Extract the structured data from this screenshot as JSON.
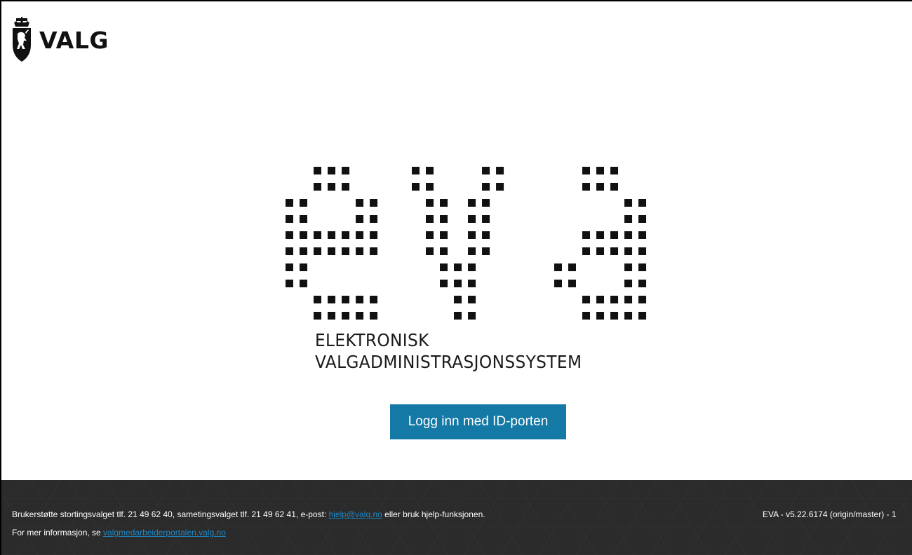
{
  "header": {
    "brand_text": "VALG",
    "emblem_icon": "norwegian-coat-of-arms-icon"
  },
  "hero": {
    "logo_text": "eva",
    "logo_icon": "eva-dot-matrix-logo",
    "subtitle_line1": "ELEKTRONISK",
    "subtitle_line2": "VALGADMINISTRASJONSSYSTEM"
  },
  "login": {
    "button_label": "Logg inn med ID-porten"
  },
  "footer": {
    "support_prefix": "Brukerstøtte stortingsvalget tlf. 21 49 62 40, sametingsvalget tlf. 21 49 62 41, e-post: ",
    "support_email": "hjelp@valg.no",
    "support_suffix": " eller bruk hjelp-funksjonen.",
    "info_prefix": "For mer informasjon, se ",
    "info_link": "valgmedarbeiderportalen.valg.no",
    "version": "EVA - v5.22.6174 (origin/master) - 1"
  },
  "colors": {
    "button_bg": "#1479a5",
    "footer_bg": "#2b2b2b",
    "link": "#1e88c7",
    "text": "#1a1a1a"
  }
}
